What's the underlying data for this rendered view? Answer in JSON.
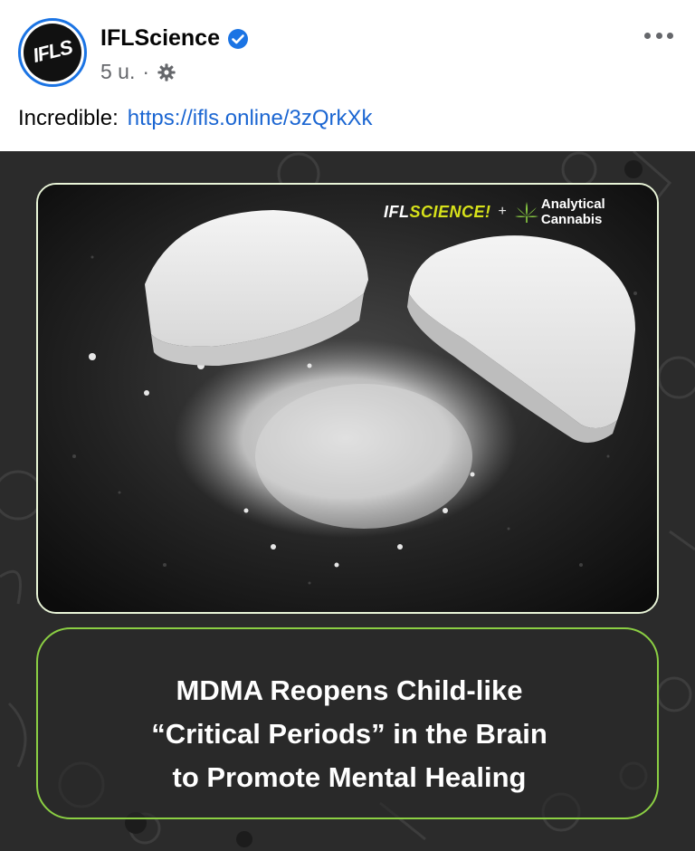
{
  "post": {
    "page_name": "IFLScience",
    "avatar_label": "IFLS",
    "time": "5 u.",
    "separator": "·",
    "text_prefix": "Incredible:",
    "link": "https://ifls.online/3zQrkXk"
  },
  "media": {
    "logo_ifl_part1": "IFL",
    "logo_ifl_part2": "SCIENCE!",
    "logo_plus": "+",
    "logo_partner": "Analytical Cannabis",
    "headline_lines": [
      "MDMA Reopens Child-like",
      "“Critical Periods” in the Brain",
      "to Promote Mental Healing"
    ]
  },
  "colors": {
    "link": "#1b66d2",
    "verified": "#1b74e4",
    "accent_green": "#8bcf43",
    "secondary_text": "#65676b"
  },
  "icons": {
    "verified": "verified-badge-icon",
    "privacy": "globe-gear-icon",
    "more": "more-options-icon",
    "partner": "cannabis-leaf-icon"
  }
}
